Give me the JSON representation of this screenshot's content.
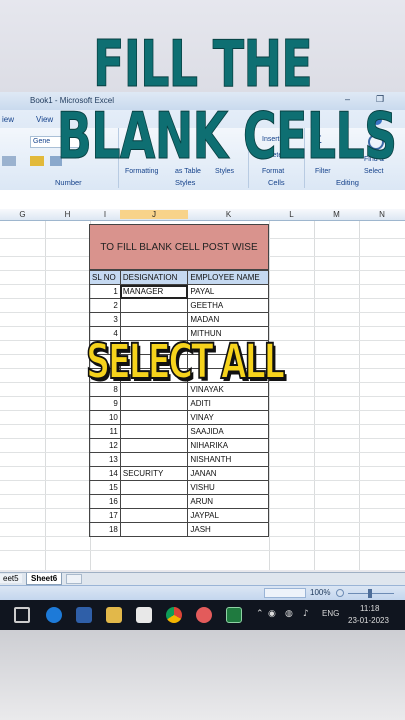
{
  "headline": {
    "line1": "FILL THE",
    "line2": "BLANK CELLS"
  },
  "window": {
    "title": "Book1 - Microsoft Excel",
    "minimize": "–",
    "restore": "❐"
  },
  "ribbon": {
    "tabs": [
      "iew",
      "View"
    ],
    "font_box": "Gene",
    "groups": [
      "Number",
      "Styles",
      "Cells",
      "Editing"
    ],
    "labels": {
      "conditional_formatting": "Formatting",
      "format_as_table": "as Table",
      "cell_styles": "Styles",
      "insert": "Insert",
      "delete": "Delete",
      "format": "Format",
      "sum": "Σ",
      "find_select": "Find &",
      "select": "Select",
      "filter": "Filter"
    }
  },
  "columns": [
    "G",
    "H",
    "I",
    "J",
    "K",
    "L",
    "M",
    "N"
  ],
  "table": {
    "title": "TO FILL BLANK CELL POST WISE",
    "headers": [
      "SL NO",
      "DESIGNATION",
      "EMPLOYEE NAME"
    ],
    "rows": [
      [
        "1",
        "MANAGER",
        "PAYAL"
      ],
      [
        "2",
        "",
        "GEETHA"
      ],
      [
        "3",
        "",
        "MADAN"
      ],
      [
        "4",
        "",
        "MITHUN"
      ],
      [
        "5",
        "",
        ""
      ],
      [
        "6",
        "",
        ""
      ],
      [
        "7",
        "",
        ""
      ],
      [
        "8",
        "",
        "VINAYAK"
      ],
      [
        "9",
        "",
        "ADITI"
      ],
      [
        "10",
        "",
        "VINAY"
      ],
      [
        "11",
        "",
        "SAAJIDA"
      ],
      [
        "12",
        "",
        "NIHARIKA"
      ],
      [
        "13",
        "",
        "NISHANTH"
      ],
      [
        "14",
        "SECURITY",
        "JANAN"
      ],
      [
        "15",
        "",
        "VISHU"
      ],
      [
        "16",
        "",
        "ARUN"
      ],
      [
        "17",
        "",
        "JAYPAL"
      ],
      [
        "18",
        "",
        "JASH"
      ]
    ]
  },
  "overlay_caption": "SELECT ALL",
  "sheet_tabs": [
    "eet5",
    "Sheet6"
  ],
  "zoom": "100%",
  "taskbar": {
    "language": "ENG",
    "time": "11:18",
    "date": "23-01-2023"
  },
  "colors": {
    "headline": "#0e6f72",
    "caption": "#f6d31c",
    "title_cell": "#d9938d",
    "header_row": "#c5d9f1"
  }
}
